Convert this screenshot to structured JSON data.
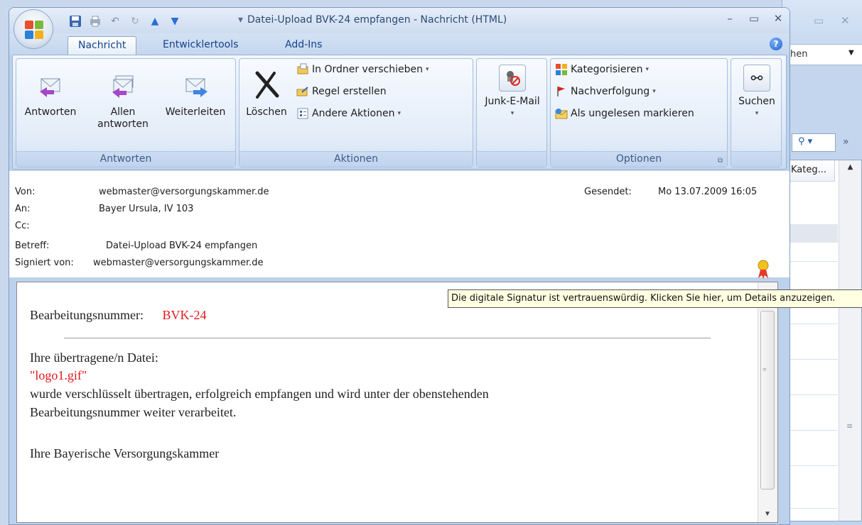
{
  "background_window": {
    "search_partial": "hen",
    "column_header": "Kateg..."
  },
  "titlebar": {
    "title_pre": "▾",
    "title": "Datei-Upload BVK-24 empfangen - Nachricht (HTML)"
  },
  "tabs": [
    {
      "label": "Nachricht",
      "active": true
    },
    {
      "label": "Entwicklertools",
      "active": false
    },
    {
      "label": "Add-Ins",
      "active": false
    }
  ],
  "ribbon": {
    "antworten_group": {
      "label": "Antworten",
      "reply": "Antworten",
      "reply_all_line1": "Allen",
      "reply_all_line2": "antworten",
      "forward": "Weiterleiten"
    },
    "aktionen_group": {
      "label": "Aktionen",
      "delete": "Löschen",
      "move": "In Ordner verschieben",
      "rule": "Regel erstellen",
      "other": "Andere Aktionen"
    },
    "junk_group": {
      "junk": "Junk-E-Mail"
    },
    "optionen_group": {
      "label": "Optionen",
      "categorize": "Kategorisieren",
      "followup": "Nachverfolgung",
      "unread": "Als ungelesen markieren"
    },
    "suchen_group": {
      "find": "Suchen"
    }
  },
  "header": {
    "from_label": "Von:",
    "from_value": "webmaster@versorgungskammer.de",
    "to_label": "An:",
    "to_value": "Bayer Ursula, IV 103",
    "cc_label": "Cc:",
    "cc_value": "",
    "subject_label": "Betreff:",
    "subject_value": "Datei-Upload BVK-24 empfangen",
    "signed_label": "Signiert von:",
    "signed_value": "webmaster@versorgungskammer.de",
    "sent_label": "Gesendet:",
    "sent_value": "Mo 13.07.2009 16:05"
  },
  "tooltip": "Die digitale Signatur ist vertrauenswürdig. Klicken Sie hier, um Details anzuzeigen.",
  "body": {
    "ref_label": "Bearbeitungsnummer:",
    "ref_value": "BVK-24",
    "file_intro": "Ihre übertragene/n Datei:",
    "file_name": "\"logo1.gif\"",
    "line1": "wurde verschlüsselt übertragen, erfolgreich empfangen und wird unter der obenstehenden",
    "line2": "Bearbeitungsnummer weiter verarbeitet.",
    "signoff": "Ihre Bayerische Versorgungskammer"
  },
  "colors": {
    "accent_red": "#e0181c",
    "ribbon_text": "#15428b",
    "tooltip_bg": "#ffffe1"
  }
}
